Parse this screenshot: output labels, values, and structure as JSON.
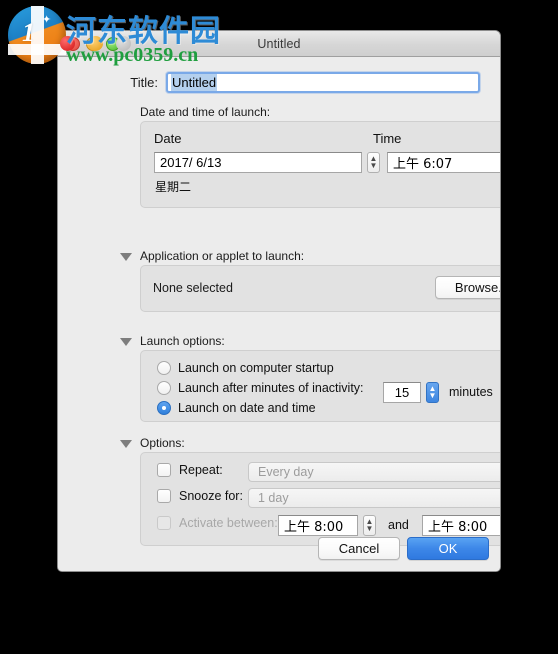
{
  "watermark": {
    "site_name_cn": "河东软件园",
    "url": "www.pc0359.cn",
    "logo_digit": "1"
  },
  "window": {
    "title": "Untitled",
    "traffic_lights": [
      "close",
      "minimize",
      "zoom"
    ]
  },
  "title_field": {
    "label": "Title:",
    "value": "Untitled",
    "selected": true
  },
  "date_section": {
    "group_label": "Date and time of launch:",
    "date_header": "Date",
    "time_header": "Time",
    "date_value": "2017/  6/13",
    "time_value": "上午  6:07",
    "weekday": "星期二"
  },
  "application_section": {
    "group_label": "Application or applet to launch:",
    "status": "None selected",
    "browse_label": "Browse..."
  },
  "launch_options": {
    "group_label": "Launch options:",
    "items": [
      {
        "label": "Launch on computer startup",
        "selected": false
      },
      {
        "label": "Launch after minutes of inactivity:",
        "selected": false
      },
      {
        "label": "Launch on date and time",
        "selected": true
      }
    ],
    "inactivity_value": "15",
    "inactivity_unit": "minutes"
  },
  "options_section": {
    "group_label": "Options:",
    "repeat_label": "Repeat:",
    "repeat_value": "Every day",
    "repeat_checked": false,
    "snooze_label": "Snooze for:",
    "snooze_value": "1 day",
    "snooze_checked": false,
    "activate_label": "Activate between:",
    "activate_checked": false,
    "activate_disabled": true,
    "activate_from": "上午  8:00",
    "activate_and": "and",
    "activate_to": "上午  8:00"
  },
  "footer": {
    "cancel_label": "Cancel",
    "ok_label": "OK"
  },
  "colors": {
    "accent_blue": "#3d87e8",
    "window_bg": "#ececec",
    "group_bg": "#e2e2e2",
    "watermark_blue": "#2E8BD6",
    "watermark_green": "#1f9e3f"
  }
}
